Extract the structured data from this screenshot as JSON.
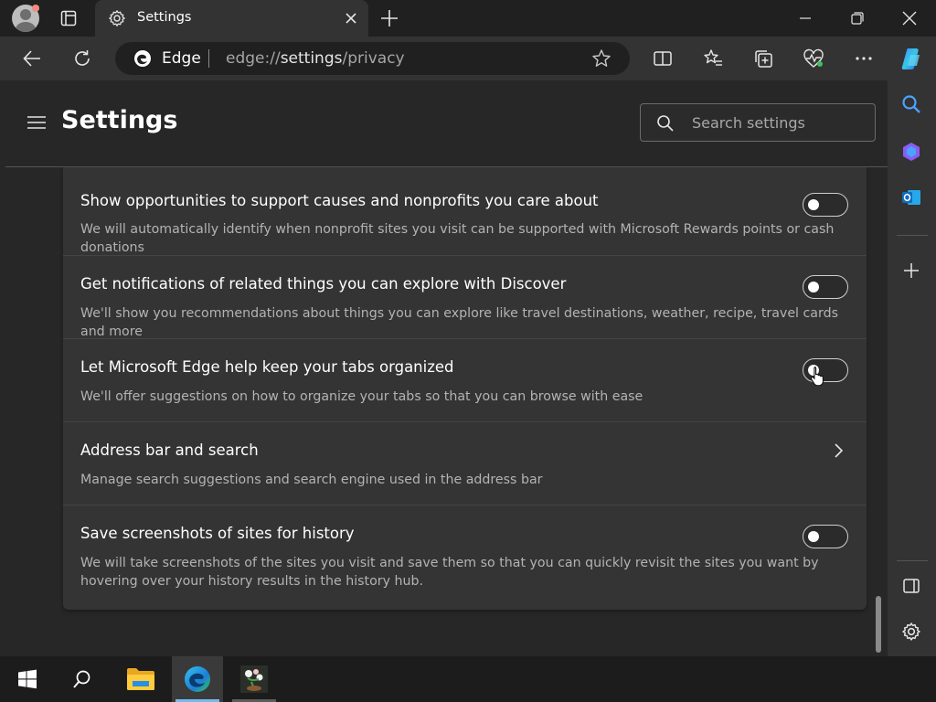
{
  "window": {
    "tab_title": "Settings"
  },
  "address_bar": {
    "site_label": "Edge",
    "url_prefix": "edge://",
    "url_main": "settings",
    "url_suffix": "/privacy"
  },
  "settings": {
    "title": "Settings",
    "search_placeholder": "Search settings"
  },
  "rows": [
    {
      "title": "Show opportunities to support causes and nonprofits you care about",
      "description": "We will automatically identify when nonprofit sites you visit can be supported with Microsoft Rewards points or cash donations",
      "control": "toggle",
      "enabled": false
    },
    {
      "title": "Get notifications of related things you can explore with Discover",
      "description": "We'll show you recommendations about things you can explore like travel destinations, weather, recipe, travel cards and more",
      "control": "toggle",
      "enabled": false
    },
    {
      "title": "Let Microsoft Edge help keep your tabs organized",
      "description": "We'll offer suggestions on how to organize your tabs so that you can browse with ease",
      "control": "toggle",
      "enabled": false
    },
    {
      "title": "Address bar and search",
      "description": "Manage search suggestions and search engine used in the address bar",
      "control": "chevron"
    },
    {
      "title": "Save screenshots of sites for history",
      "description": "We will take screenshots of the sites you visit and save them so that you can quickly revisit the sites you want by hovering over your history results in the history hub.",
      "control": "toggle",
      "enabled": false
    }
  ],
  "colors": {
    "accent_blue": "#76b9ed",
    "copilot_gradient": "#3d8bfd"
  }
}
